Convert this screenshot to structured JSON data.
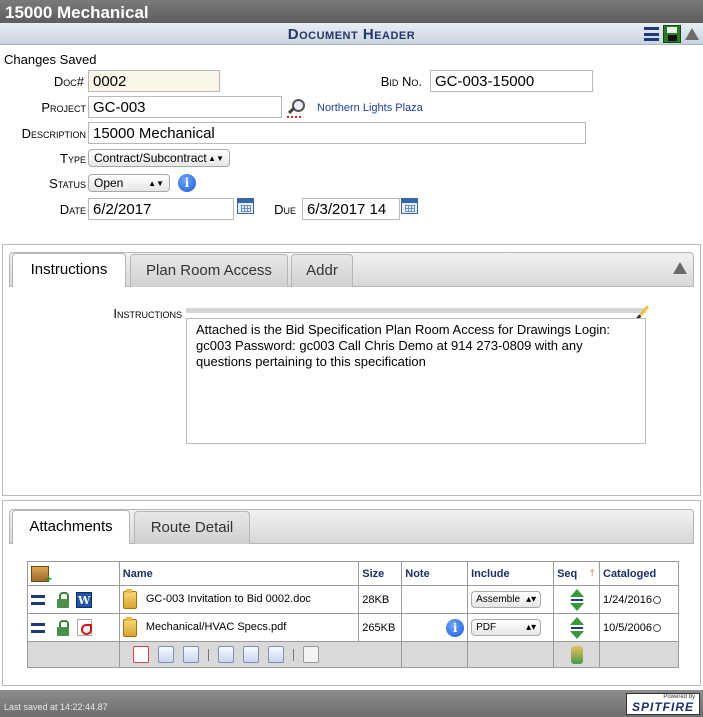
{
  "window": {
    "title": "15000 Mechanical"
  },
  "section": {
    "title": "Document Header"
  },
  "status_message": "Changes Saved",
  "labels": {
    "doc": "Doc#",
    "bid_no": "Bid No.",
    "project": "Project",
    "description": "Description",
    "type": "Type",
    "status": "Status",
    "date": "Date",
    "due": "Due",
    "instructions": "Instructions"
  },
  "fields": {
    "doc": "0002",
    "bid_no": "GC-003-15000",
    "project": "GC-003",
    "project_name": "Northern Lights Plaza",
    "description": "15000 Mechanical",
    "type": "Contract/Subcontract",
    "status": "Open",
    "date": "6/2/2017",
    "due": "6/3/2017 14"
  },
  "tabs1": [
    "Instructions",
    "Plan Room Access",
    "Addr"
  ],
  "instructions_text": "Attached is the Bid Specification Plan Room Access for Drawings Login: gc003 Password: gc003 Call Chris Demo at 914 273-0809 with any questions pertaining to this specification",
  "tabs2": [
    "Attachments",
    "Route Detail"
  ],
  "attachments": {
    "columns": [
      "Name",
      "Size",
      "Note",
      "Include",
      "Seq",
      "Cataloged"
    ],
    "rows": [
      {
        "name": "GC-003 Invitation to Bid 0002.doc",
        "size": "28KB",
        "include": "Assemble",
        "cataloged": "1/24/2016",
        "file_icon": "word-icon",
        "note_icon": ""
      },
      {
        "name": "Mechanical/HVAC Specs.pdf",
        "size": "265KB",
        "include": "PDF",
        "cataloged": "10/5/2006",
        "file_icon": "pdf-icon",
        "note_icon": "info-icon"
      }
    ]
  },
  "footer": {
    "last_saved": "Last saved at 14:22:44.87",
    "powered_by": "Powered by",
    "brand": "SPITFIRE"
  },
  "colors": {
    "section_title": "#22386b",
    "link": "#1b3f9a",
    "header_text": "#1b2f6a"
  }
}
